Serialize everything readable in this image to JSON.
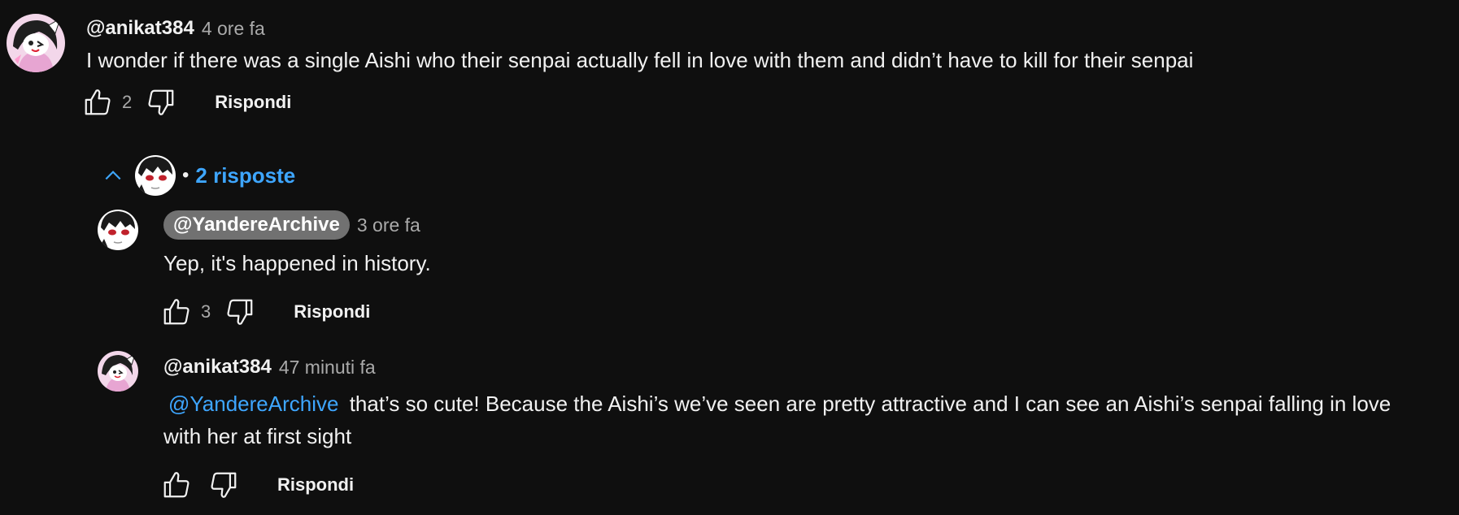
{
  "thread": {
    "comment": {
      "author": "@anikat384",
      "time": "4 ore fa",
      "text": "I wonder if there was a single Aishi who their senpai actually fell in love with them and didn’t have to kill for their senpai",
      "likes": "2",
      "reply_label": "Rispondi"
    },
    "replies_toggle": {
      "label": "2 risposte",
      "bullet": "•"
    },
    "replies": [
      {
        "author": "@YandereArchive",
        "time": "3 ore fa",
        "text": "Yep, it's happened in history.",
        "likes": "3",
        "reply_label": "Rispondi"
      },
      {
        "author": "@anikat384",
        "time": "47 minuti fa",
        "mention": "@YandereArchive",
        "text": "that’s so cute! Because the Aishi’s we’ve seen are pretty attractive and I can see an Aishi’s senpai falling in love with her at first sight",
        "likes": "",
        "reply_label": "Rispondi"
      }
    ]
  },
  "colors": {
    "background": "#0f0f0f",
    "link": "#3ea6ff",
    "secondary_text": "#aaaaaa",
    "owner_pill": "#717171"
  },
  "icons": [
    "thumbs-up-icon",
    "thumbs-down-icon",
    "chevron-up-icon",
    "avatar-anime-girl",
    "avatar-yandere"
  ]
}
